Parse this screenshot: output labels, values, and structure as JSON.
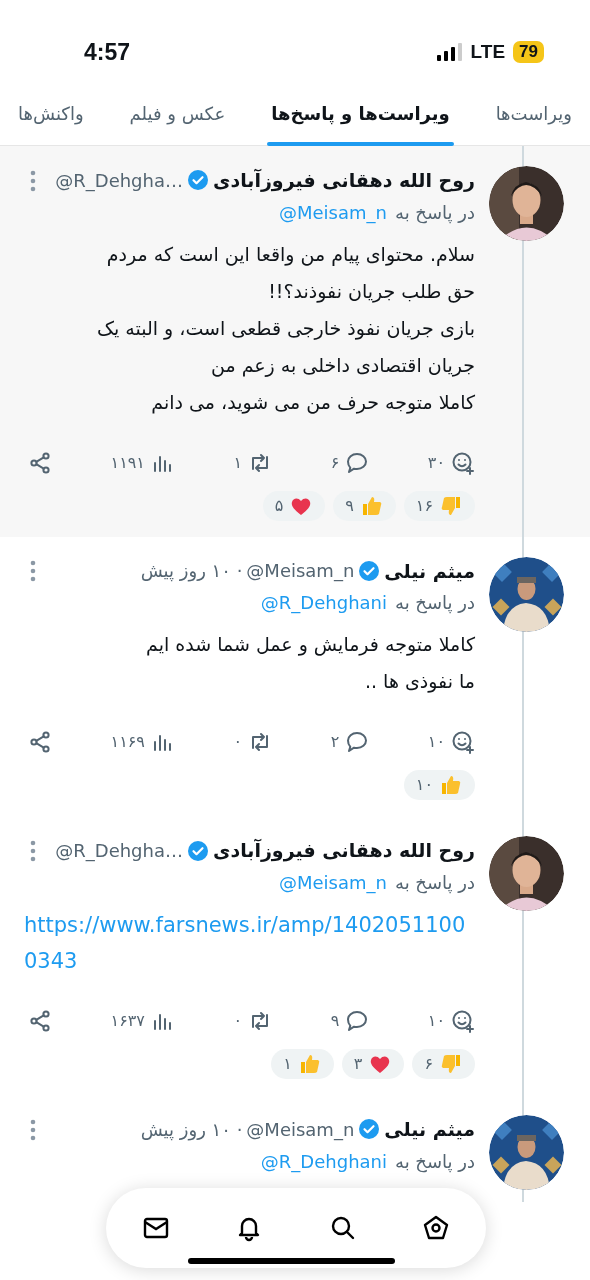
{
  "status_bar": {
    "time": "4:57",
    "network": "LTE",
    "battery": "79"
  },
  "tabs": [
    {
      "label": "ویراست‌ها",
      "selected": false
    },
    {
      "label": "ویراست‌ها و پاسخ‌ها",
      "selected": true
    },
    {
      "label": "عکس و فیلم",
      "selected": false
    },
    {
      "label": "واکنش‌ها",
      "selected": false
    }
  ],
  "posts": [
    {
      "highlighted": true,
      "name": "روح الله دهقانی فیروزآبادی",
      "verified": true,
      "handle": "@R_Dehgha…",
      "reply_prefix": "در پاسخ به",
      "reply_to": "@Meisam_n",
      "body": "سلام. محتوای پیام من واقعا این است که مردم\nحق طلب جریان نفوذند؟!!\nبازی جریان نفوذ خارجی قطعی است، و البته یک\nجریان اقتصادی داخلی به زعم من\nکاملا متوجه حرف من می شوید، می دانم",
      "actions": {
        "reactions": "۳۰",
        "replies": "۶",
        "reposts": "۱",
        "views": "۱۱۹۱"
      },
      "reactions": [
        {
          "kind": "dislike",
          "count": "۱۶"
        },
        {
          "kind": "like",
          "count": "۹"
        },
        {
          "kind": "heart",
          "count": "۵"
        }
      ]
    },
    {
      "highlighted": false,
      "name": "میثم نیلی",
      "verified": true,
      "handle": "@Meisam_n",
      "time": "· ۱۰ روز پیش",
      "reply_prefix": "در پاسخ به",
      "reply_to": "@R_Dehghani",
      "body": "کاملا متوجه فرمایش و عمل شما شده ایم\nما نفوذی ها ..",
      "actions": {
        "reactions": "۱۰",
        "replies": "۲",
        "reposts": "۰",
        "views": "۱۱۶۹"
      },
      "reactions": [
        {
          "kind": "like",
          "count": "۱۰"
        }
      ]
    },
    {
      "highlighted": false,
      "name": "روح الله دهقانی فیروزآبادی",
      "verified": true,
      "handle": "@R_Dehgha…",
      "reply_prefix": "در پاسخ به",
      "reply_to": "@Meisam_n",
      "link": "https://www.farsnews.ir/amp/14020511000343",
      "actions": {
        "reactions": "۱۰",
        "replies": "۹",
        "reposts": "۰",
        "views": "۱۶۳۷"
      },
      "reactions": [
        {
          "kind": "dislike",
          "count": "۶"
        },
        {
          "kind": "heart",
          "count": "۳"
        },
        {
          "kind": "like",
          "count": "۱"
        }
      ]
    },
    {
      "highlighted": false,
      "name": "میثم نیلی",
      "verified": true,
      "handle": "@Meisam_n",
      "time": "· ۱۰ روز پیش",
      "reply_prefix": "در پاسخ به",
      "reply_to": "@R_Dehghani"
    }
  ]
}
